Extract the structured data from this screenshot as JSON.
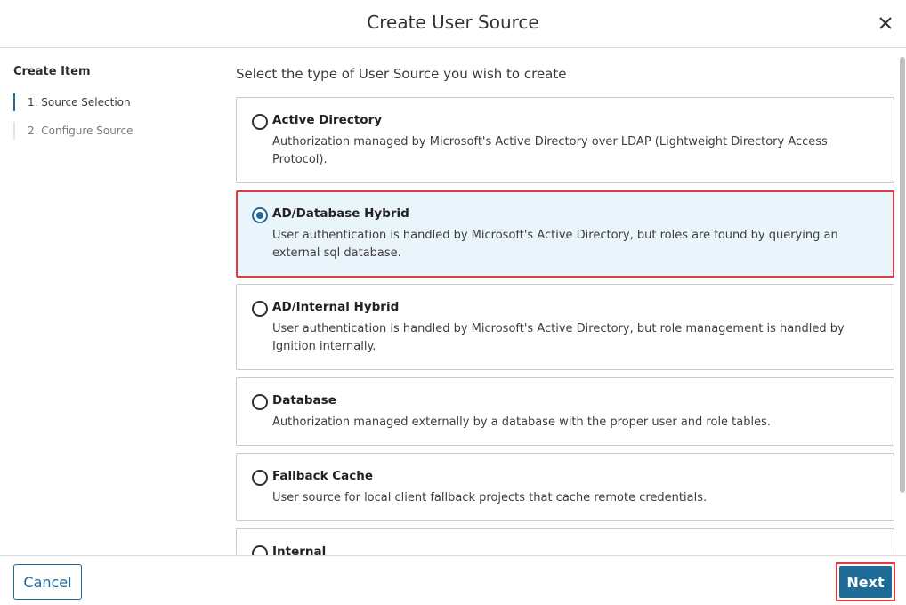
{
  "dialog": {
    "title": "Create User Source",
    "close_icon": "close-icon"
  },
  "sidebar": {
    "heading": "Create Item",
    "steps": [
      {
        "label": "1. Source Selection",
        "active": true
      },
      {
        "label": "2. Configure Source",
        "active": false
      }
    ]
  },
  "main": {
    "prompt": "Select the type of User Source you wish to create",
    "options": [
      {
        "title": "Active Directory",
        "description": "Authorization managed by Microsoft's Active Directory over LDAP (Lightweight Directory Access Protocol).",
        "selected": false
      },
      {
        "title": "AD/Database Hybrid",
        "description": "User authentication is handled by Microsoft's Active Directory, but roles are found by querying an external sql database.",
        "selected": true
      },
      {
        "title": "AD/Internal Hybrid",
        "description": "User authentication is handled by Microsoft's Active Directory, but role management is handled by Ignition internally.",
        "selected": false
      },
      {
        "title": "Database",
        "description": "Authorization managed externally by a database with the proper user and role tables.",
        "selected": false
      },
      {
        "title": "Fallback Cache",
        "description": "User source for local client fallback projects that cache remote credentials.",
        "selected": false
      },
      {
        "title": "Internal",
        "description": "",
        "selected": false
      }
    ]
  },
  "footer": {
    "cancel_label": "Cancel",
    "next_label": "Next"
  },
  "colors": {
    "accent": "#1f6b97",
    "highlight_border": "#e5393f",
    "selected_bg": "#eaf4fb"
  }
}
